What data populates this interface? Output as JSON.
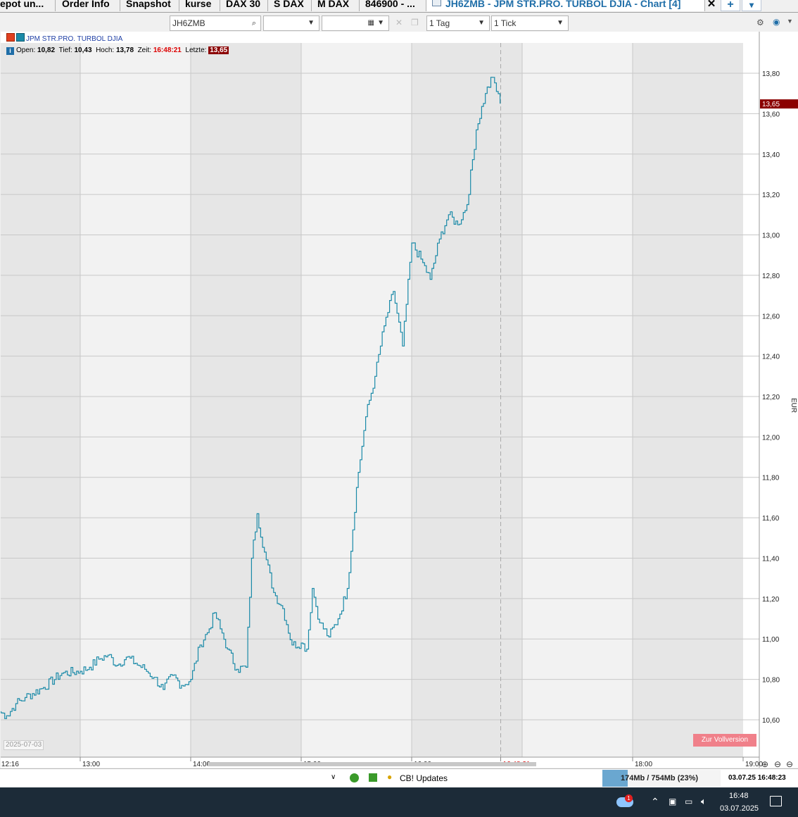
{
  "tabs": [
    {
      "label": "epot un...",
      "active": false
    },
    {
      "label": "Order Info",
      "active": false
    },
    {
      "label": "Snapshot",
      "active": false
    },
    {
      "label": "kurse",
      "active": false
    },
    {
      "label": "DAX 30",
      "active": false
    },
    {
      "label": "S DAX",
      "active": false
    },
    {
      "label": "M DAX",
      "active": false
    },
    {
      "label": "846900 - ...",
      "active": false
    },
    {
      "label": "JH6ZMB - JPM STR.PRO. TURBOL DJIA - Chart [4]",
      "active": true
    }
  ],
  "tab_actions": {
    "close": "✕",
    "add": "+",
    "menu": "▾"
  },
  "toolbar": {
    "symbol": "JH6ZMB",
    "period": "1 Tag",
    "interval": "1 Tick"
  },
  "legend": {
    "instrument": "JPM STR.PRO. TURBOL DJIA",
    "open_label": "Open:",
    "open": "10,82",
    "low_label": "Tief:",
    "low": "10,43",
    "high_label": "Hoch:",
    "high": "13,78",
    "time_label": "Zeit:",
    "time": "16:48:21",
    "last_label": "Letzte:",
    "last": "13,65"
  },
  "chart_data": {
    "type": "line",
    "ylabel": "EUR",
    "ylim": [
      10.45,
      13.95
    ],
    "y_ticks": [
      "10,60",
      "10,80",
      "11,00",
      "11,20",
      "11,40",
      "11,60",
      "11,80",
      "12,00",
      "12,20",
      "12,40",
      "12,60",
      "12,80",
      "13,00",
      "13,20",
      "13,40",
      "13,60",
      "13,80"
    ],
    "x_ticks": [
      "12:16",
      "13:00",
      "14:00",
      "15:00",
      "16:00",
      "16:48:21",
      "18:00",
      "19:00"
    ],
    "current_time_label": "16:48:21",
    "last_price_label": "13,65",
    "date_label": "2025-07-03",
    "line_color": "#1a8aa8",
    "series": [
      {
        "points": [
          [
            "12:16",
            10.64
          ],
          [
            "12:20",
            10.62
          ],
          [
            "12:25",
            10.68
          ],
          [
            "12:30",
            10.71
          ],
          [
            "12:40",
            10.76
          ],
          [
            "12:50",
            10.83
          ],
          [
            "13:00",
            10.84
          ],
          [
            "13:05",
            10.86
          ],
          [
            "13:10",
            10.9
          ],
          [
            "13:15",
            10.92
          ],
          [
            "13:20",
            10.87
          ],
          [
            "13:25",
            10.91
          ],
          [
            "13:30",
            10.88
          ],
          [
            "13:35",
            10.85
          ],
          [
            "13:40",
            10.81
          ],
          [
            "13:45",
            10.75
          ],
          [
            "13:50",
            10.82
          ],
          [
            "13:55",
            10.77
          ],
          [
            "14:00",
            10.8
          ],
          [
            "14:05",
            10.97
          ],
          [
            "14:10",
            11.05
          ],
          [
            "14:13",
            11.13
          ],
          [
            "14:16",
            11.05
          ],
          [
            "14:20",
            10.95
          ],
          [
            "14:25",
            10.85
          ],
          [
            "14:30",
            10.86
          ],
          [
            "14:33",
            11.4
          ],
          [
            "14:36",
            11.62
          ],
          [
            "14:40",
            11.43
          ],
          [
            "14:45",
            11.23
          ],
          [
            "14:50",
            11.15
          ],
          [
            "14:55",
            10.97
          ],
          [
            "15:00",
            10.98
          ],
          [
            "15:03",
            10.95
          ],
          [
            "15:06",
            11.25
          ],
          [
            "15:10",
            11.08
          ],
          [
            "15:15",
            11.01
          ],
          [
            "15:20",
            11.1
          ],
          [
            "15:25",
            11.25
          ],
          [
            "15:30",
            11.75
          ],
          [
            "15:35",
            12.1
          ],
          [
            "15:40",
            12.3
          ],
          [
            "15:45",
            12.55
          ],
          [
            "15:50",
            12.72
          ],
          [
            "15:55",
            12.45
          ],
          [
            "16:00",
            12.96
          ],
          [
            "16:05",
            12.88
          ],
          [
            "16:10",
            12.78
          ],
          [
            "16:15",
            12.98
          ],
          [
            "16:20",
            13.1
          ],
          [
            "16:25",
            13.05
          ],
          [
            "16:30",
            13.15
          ],
          [
            "16:35",
            13.52
          ],
          [
            "16:40",
            13.7
          ],
          [
            "16:44",
            13.78
          ],
          [
            "16:48",
            13.65
          ]
        ]
      }
    ]
  },
  "buttons": {
    "vollversion": "Zur Vollversion"
  },
  "status": {
    "updates": "CB! Updates",
    "memory": "174Mb / 754Mb (23%)",
    "datetime": "03.07.25  16:48:23"
  },
  "taskbar": {
    "time": "16:48",
    "date": "03.07.2025",
    "weather_badge": "1"
  }
}
